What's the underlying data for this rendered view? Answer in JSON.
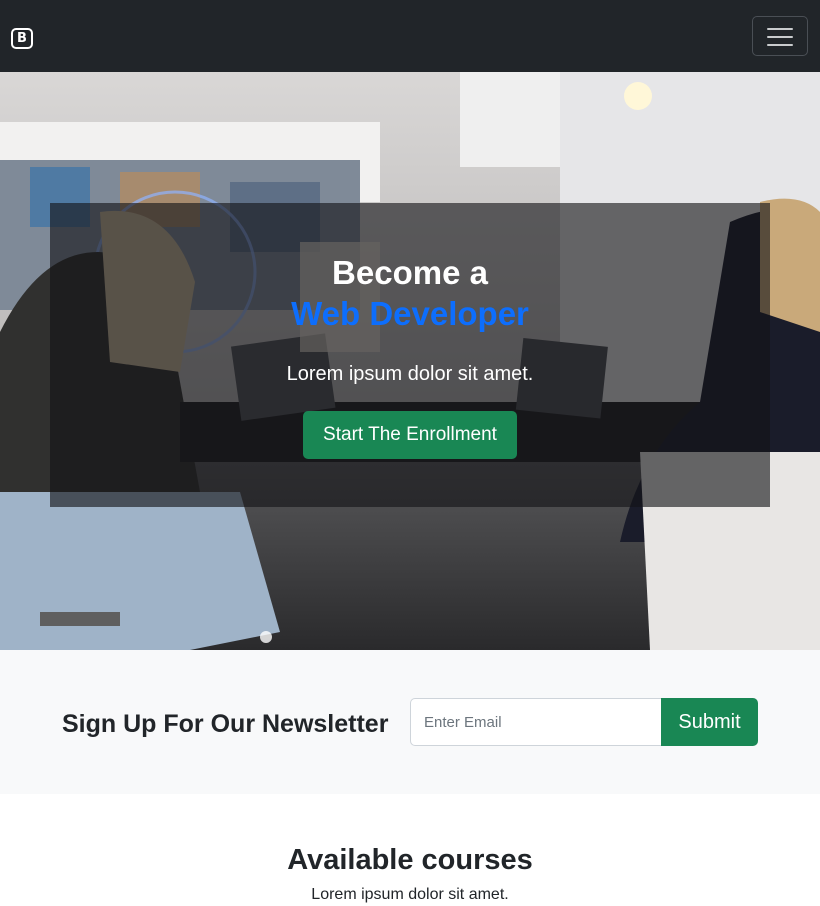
{
  "navbar": {
    "brand_letter": "B",
    "brand_icon": "bootstrap-logo-icon",
    "toggler_icon": "hamburger-menu-icon"
  },
  "hero": {
    "title_line1": "Become a",
    "title_line2": "Web Developer",
    "text": "Lorem ipsum dolor sit amet.",
    "button_label": "Start The Enrollment"
  },
  "newsletter": {
    "title": "Sign Up For Our Newsletter",
    "email_placeholder": "Enter Email",
    "email_value": "",
    "submit_label": "Submit"
  },
  "courses": {
    "title": "Available courses",
    "subtitle": "Lorem ipsum dolor sit amet."
  },
  "colors": {
    "navbar_bg": "#212529",
    "accent_blue": "#0d6efd",
    "success_green": "#198754",
    "light_bg": "#f8f9fa"
  }
}
